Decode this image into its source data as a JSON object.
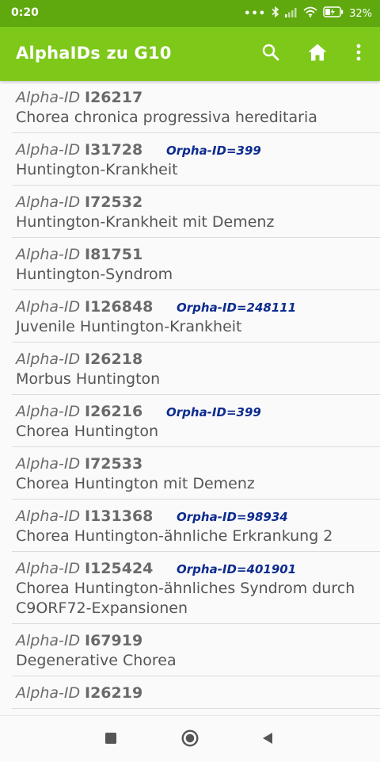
{
  "status_bar": {
    "time": "0:20",
    "battery": "32%",
    "dots": "•••"
  },
  "toolbar": {
    "title": "AlphaIDs zu G10",
    "icons": [
      "search-icon",
      "home-icon",
      "more-vert-icon"
    ]
  },
  "items": [
    {
      "alpha_label": "Alpha-ID",
      "code": "I26217",
      "orpha": "",
      "name": "Chorea chronica progressiva hereditaria"
    },
    {
      "alpha_label": "Alpha-ID",
      "code": "I31728",
      "orpha": "Orpha-ID=399",
      "name": "Huntington-Krankheit"
    },
    {
      "alpha_label": "Alpha-ID",
      "code": "I72532",
      "orpha": "",
      "name": "Huntington-Krankheit mit Demenz"
    },
    {
      "alpha_label": "Alpha-ID",
      "code": "I81751",
      "orpha": "",
      "name": "Huntington-Syndrom"
    },
    {
      "alpha_label": "Alpha-ID",
      "code": "I126848",
      "orpha": "Orpha-ID=248111",
      "name": "Juvenile Huntington-Krankheit"
    },
    {
      "alpha_label": "Alpha-ID",
      "code": "I26218",
      "orpha": "",
      "name": "Morbus Huntington"
    },
    {
      "alpha_label": "Alpha-ID",
      "code": "I26216",
      "orpha": "Orpha-ID=399",
      "name": "Chorea Huntington"
    },
    {
      "alpha_label": "Alpha-ID",
      "code": "I72533",
      "orpha": "",
      "name": "Chorea Huntington mit Demenz"
    },
    {
      "alpha_label": "Alpha-ID",
      "code": "I131368",
      "orpha": "Orpha-ID=98934",
      "name": "Chorea Huntington-ähnliche Erkrankung 2"
    },
    {
      "alpha_label": "Alpha-ID",
      "code": "I125424",
      "orpha": "Orpha-ID=401901",
      "name": "Chorea Huntington-ähnliches Syndrom durch C9ORF72-Expansionen"
    },
    {
      "alpha_label": "Alpha-ID",
      "code": "I67919",
      "orpha": "",
      "name": "Degenerative Chorea"
    },
    {
      "alpha_label": "Alpha-ID",
      "code": "I26219",
      "orpha": "",
      "name": ""
    }
  ],
  "nav_bar": {
    "icons": [
      "recents-square-icon",
      "home-circle-icon",
      "back-triangle-icon"
    ]
  },
  "colors": {
    "status_bar": "#5fa90f",
    "toolbar": "#7ec81a",
    "orpha_text": "#0d2c8f",
    "background": "#fafafa"
  }
}
